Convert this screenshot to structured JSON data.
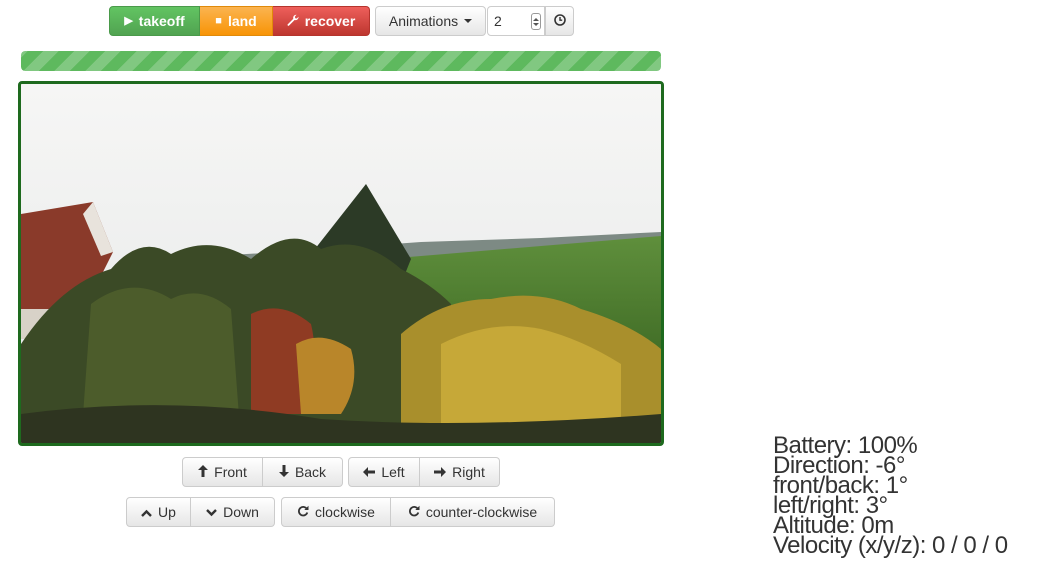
{
  "toolbar": {
    "takeoff_label": "takeoff",
    "land_label": "land",
    "recover_label": "recover",
    "animations_label": "Animations",
    "animation_duration_value": "2"
  },
  "progress": {
    "percent": 100,
    "color": "#5eb95e"
  },
  "video": {
    "border_color": "#1e6a1e"
  },
  "controls": {
    "front": "Front",
    "back": "Back",
    "left": "Left",
    "right": "Right",
    "up": "Up",
    "down": "Down",
    "clockwise": "clockwise",
    "counter_clockwise": "counter-clockwise"
  },
  "telemetry": {
    "battery": "Battery: 100%",
    "direction": "Direction: -6°",
    "front_back": "front/back: 1°",
    "left_right": "left/right: 3°",
    "altitude": "Altitude: 0m",
    "velocity": "Velocity (x/y/z): 0 / 0 / 0"
  },
  "icons": {
    "takeoff": "play-icon",
    "land": "stop-icon",
    "recover": "wrench-icon",
    "timer": "clock-icon",
    "front": "arrow-up-icon",
    "back": "arrow-down-icon",
    "left": "arrow-left-icon",
    "right": "arrow-right-icon",
    "up": "chevron-up-icon",
    "down": "chevron-down-icon",
    "rotate": "refresh-icon"
  },
  "colors": {
    "takeoff": "#51a351",
    "land": "#f89406",
    "recover": "#bd362f"
  }
}
